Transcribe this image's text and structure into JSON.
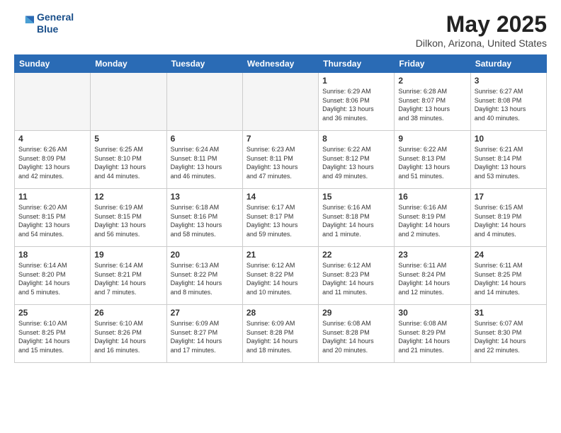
{
  "logo": {
    "line1": "General",
    "line2": "Blue"
  },
  "title": "May 2025",
  "subtitle": "Dilkon, Arizona, United States",
  "weekdays": [
    "Sunday",
    "Monday",
    "Tuesday",
    "Wednesday",
    "Thursday",
    "Friday",
    "Saturday"
  ],
  "weeks": [
    [
      {
        "day": "",
        "info": ""
      },
      {
        "day": "",
        "info": ""
      },
      {
        "day": "",
        "info": ""
      },
      {
        "day": "",
        "info": ""
      },
      {
        "day": "1",
        "info": "Sunrise: 6:29 AM\nSunset: 8:06 PM\nDaylight: 13 hours\nand 36 minutes."
      },
      {
        "day": "2",
        "info": "Sunrise: 6:28 AM\nSunset: 8:07 PM\nDaylight: 13 hours\nand 38 minutes."
      },
      {
        "day": "3",
        "info": "Sunrise: 6:27 AM\nSunset: 8:08 PM\nDaylight: 13 hours\nand 40 minutes."
      }
    ],
    [
      {
        "day": "4",
        "info": "Sunrise: 6:26 AM\nSunset: 8:09 PM\nDaylight: 13 hours\nand 42 minutes."
      },
      {
        "day": "5",
        "info": "Sunrise: 6:25 AM\nSunset: 8:10 PM\nDaylight: 13 hours\nand 44 minutes."
      },
      {
        "day": "6",
        "info": "Sunrise: 6:24 AM\nSunset: 8:11 PM\nDaylight: 13 hours\nand 46 minutes."
      },
      {
        "day": "7",
        "info": "Sunrise: 6:23 AM\nSunset: 8:11 PM\nDaylight: 13 hours\nand 47 minutes."
      },
      {
        "day": "8",
        "info": "Sunrise: 6:22 AM\nSunset: 8:12 PM\nDaylight: 13 hours\nand 49 minutes."
      },
      {
        "day": "9",
        "info": "Sunrise: 6:22 AM\nSunset: 8:13 PM\nDaylight: 13 hours\nand 51 minutes."
      },
      {
        "day": "10",
        "info": "Sunrise: 6:21 AM\nSunset: 8:14 PM\nDaylight: 13 hours\nand 53 minutes."
      }
    ],
    [
      {
        "day": "11",
        "info": "Sunrise: 6:20 AM\nSunset: 8:15 PM\nDaylight: 13 hours\nand 54 minutes."
      },
      {
        "day": "12",
        "info": "Sunrise: 6:19 AM\nSunset: 8:15 PM\nDaylight: 13 hours\nand 56 minutes."
      },
      {
        "day": "13",
        "info": "Sunrise: 6:18 AM\nSunset: 8:16 PM\nDaylight: 13 hours\nand 58 minutes."
      },
      {
        "day": "14",
        "info": "Sunrise: 6:17 AM\nSunset: 8:17 PM\nDaylight: 13 hours\nand 59 minutes."
      },
      {
        "day": "15",
        "info": "Sunrise: 6:16 AM\nSunset: 8:18 PM\nDaylight: 14 hours\nand 1 minute."
      },
      {
        "day": "16",
        "info": "Sunrise: 6:16 AM\nSunset: 8:19 PM\nDaylight: 14 hours\nand 2 minutes."
      },
      {
        "day": "17",
        "info": "Sunrise: 6:15 AM\nSunset: 8:19 PM\nDaylight: 14 hours\nand 4 minutes."
      }
    ],
    [
      {
        "day": "18",
        "info": "Sunrise: 6:14 AM\nSunset: 8:20 PM\nDaylight: 14 hours\nand 5 minutes."
      },
      {
        "day": "19",
        "info": "Sunrise: 6:14 AM\nSunset: 8:21 PM\nDaylight: 14 hours\nand 7 minutes."
      },
      {
        "day": "20",
        "info": "Sunrise: 6:13 AM\nSunset: 8:22 PM\nDaylight: 14 hours\nand 8 minutes."
      },
      {
        "day": "21",
        "info": "Sunrise: 6:12 AM\nSunset: 8:22 PM\nDaylight: 14 hours\nand 10 minutes."
      },
      {
        "day": "22",
        "info": "Sunrise: 6:12 AM\nSunset: 8:23 PM\nDaylight: 14 hours\nand 11 minutes."
      },
      {
        "day": "23",
        "info": "Sunrise: 6:11 AM\nSunset: 8:24 PM\nDaylight: 14 hours\nand 12 minutes."
      },
      {
        "day": "24",
        "info": "Sunrise: 6:11 AM\nSunset: 8:25 PM\nDaylight: 14 hours\nand 14 minutes."
      }
    ],
    [
      {
        "day": "25",
        "info": "Sunrise: 6:10 AM\nSunset: 8:25 PM\nDaylight: 14 hours\nand 15 minutes."
      },
      {
        "day": "26",
        "info": "Sunrise: 6:10 AM\nSunset: 8:26 PM\nDaylight: 14 hours\nand 16 minutes."
      },
      {
        "day": "27",
        "info": "Sunrise: 6:09 AM\nSunset: 8:27 PM\nDaylight: 14 hours\nand 17 minutes."
      },
      {
        "day": "28",
        "info": "Sunrise: 6:09 AM\nSunset: 8:28 PM\nDaylight: 14 hours\nand 18 minutes."
      },
      {
        "day": "29",
        "info": "Sunrise: 6:08 AM\nSunset: 8:28 PM\nDaylight: 14 hours\nand 20 minutes."
      },
      {
        "day": "30",
        "info": "Sunrise: 6:08 AM\nSunset: 8:29 PM\nDaylight: 14 hours\nand 21 minutes."
      },
      {
        "day": "31",
        "info": "Sunrise: 6:07 AM\nSunset: 8:30 PM\nDaylight: 14 hours\nand 22 minutes."
      }
    ]
  ]
}
